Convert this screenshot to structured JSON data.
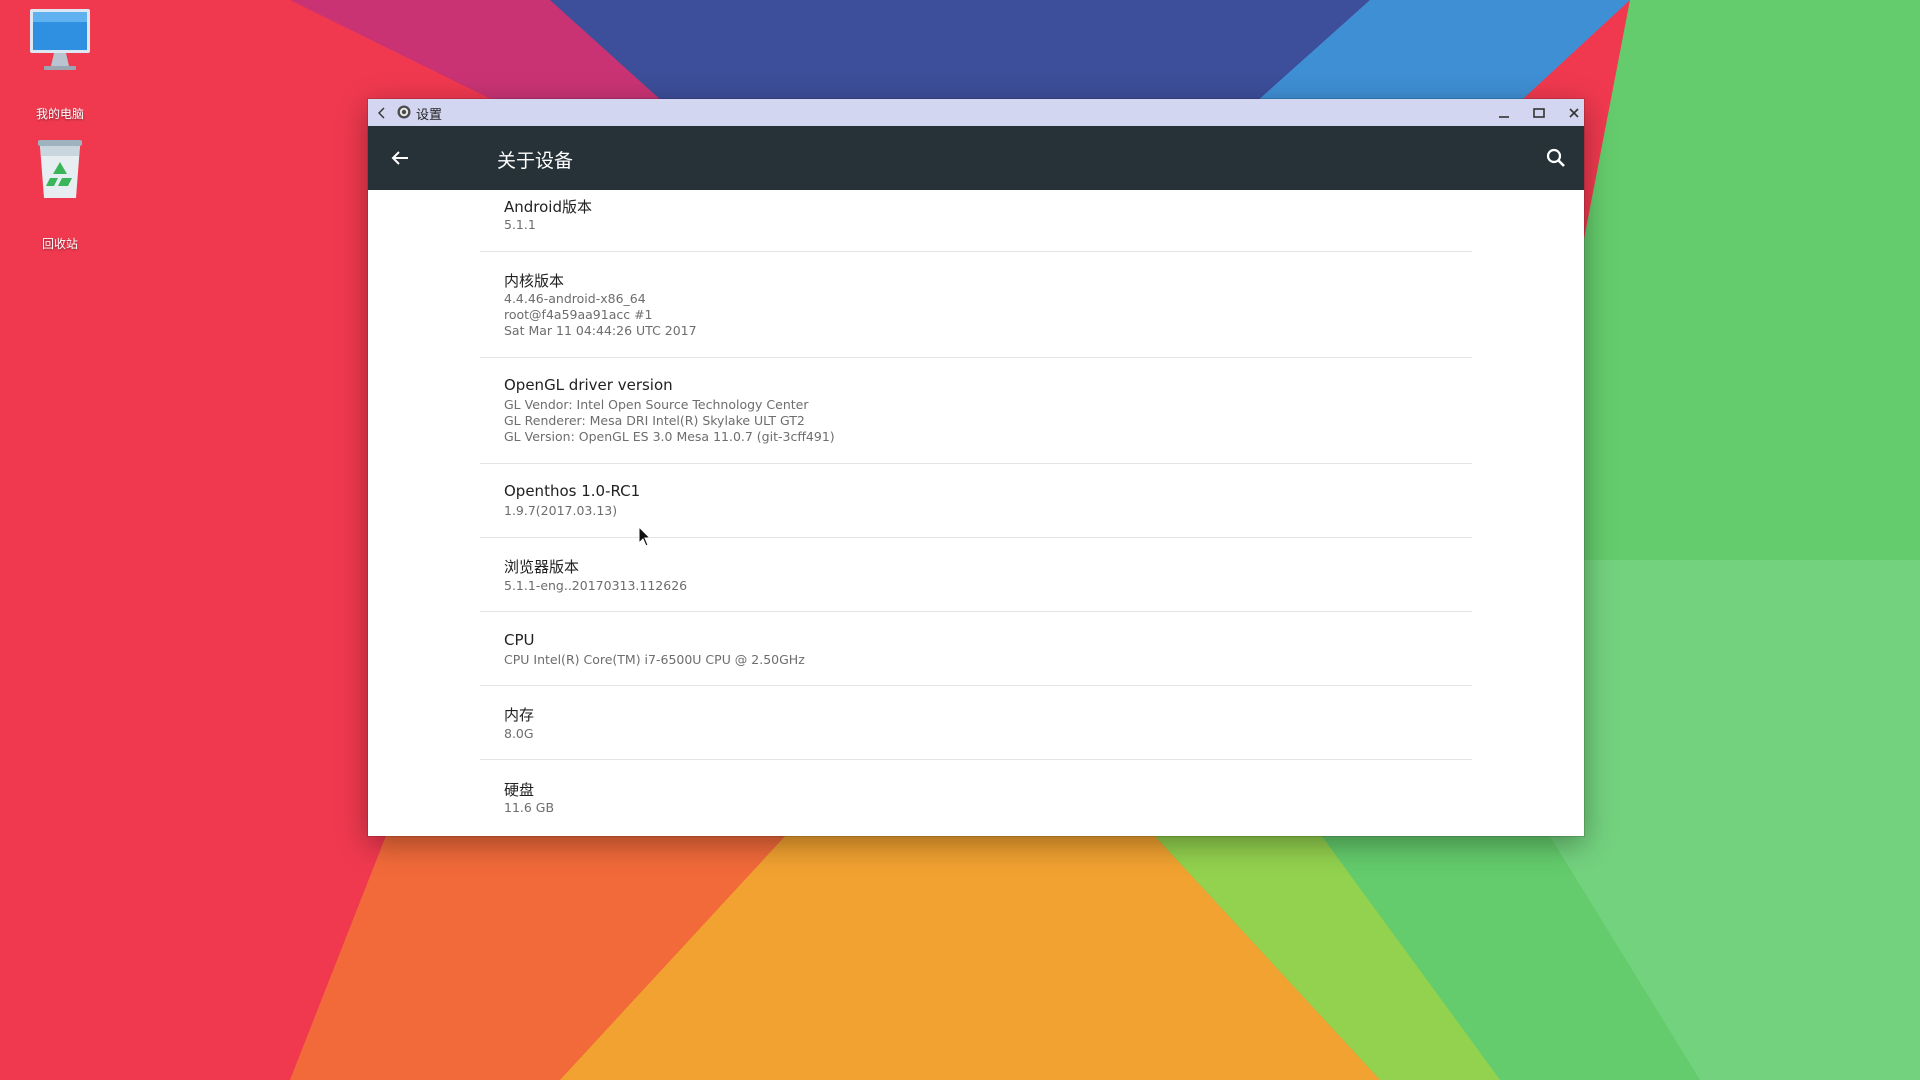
{
  "desktop": {
    "icons": [
      {
        "label": "我的电脑",
        "icon": "computer-icon"
      },
      {
        "label": "回收站",
        "icon": "recycle-bin-icon"
      }
    ]
  },
  "window": {
    "title": "设置",
    "title_icon": "gear-icon",
    "controls": {
      "minimize": "minimize-icon",
      "maximize": "maximize-icon",
      "close": "close-icon"
    }
  },
  "appbar": {
    "title": "关于设备",
    "back_icon": "arrow-left-icon",
    "search_icon": "search-icon",
    "background": "#263238"
  },
  "about": {
    "android": {
      "title": "Android版本",
      "summary": [
        "5.1.1"
      ]
    },
    "kernel": {
      "title": "内核版本",
      "summary": [
        "4.4.46-android-x86_64",
        "root@f4a59aa91acc #1",
        "Sat Mar 11 04:44:26 UTC 2017"
      ]
    },
    "opengl": {
      "title": "OpenGL driver version",
      "summary": [
        "GL Vendor: Intel Open Source Technology Center",
        "GL Renderer: Mesa DRI Intel(R) Skylake ULT GT2",
        "GL Version: OpenGL ES 3.0 Mesa 11.0.7 (git-3cff491)"
      ]
    },
    "openthos": {
      "title": "Openthos 1.0-RC1",
      "summary": [
        "1.9.7(2017.03.13)"
      ]
    },
    "browser": {
      "title": "浏览器版本",
      "summary": [
        "5.1.1-eng..20170313.112626"
      ]
    },
    "cpu": {
      "title": "CPU",
      "summary": [
        "CPU  Intel(R) Core(TM) i7-6500U CPU @ 2.50GHz"
      ]
    },
    "memory": {
      "title": "内存",
      "summary": [
        "8.0G"
      ]
    },
    "disk": {
      "title": "硬盘",
      "summary": [
        "11.6 GB"
      ]
    }
  },
  "colors": {
    "titlebar": "#d3d6f0",
    "divider": "#e4e4e4",
    "title_text": "#212121",
    "summary_text": "#6d6d6d"
  }
}
